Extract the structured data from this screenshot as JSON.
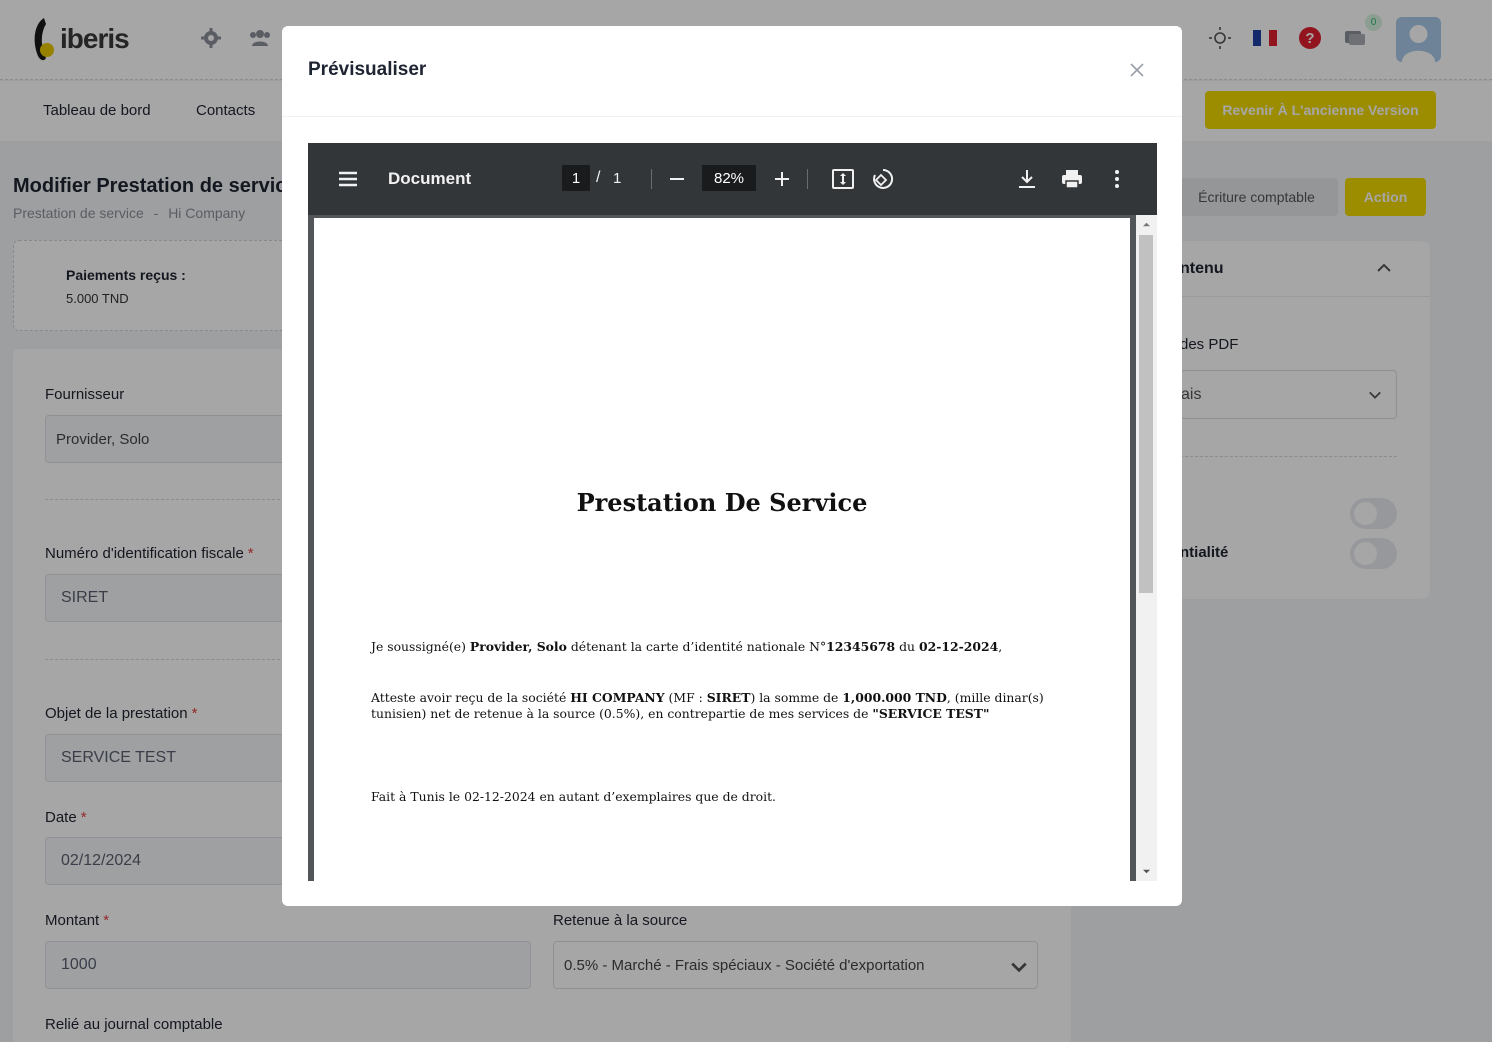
{
  "app": {
    "logo_text": "iberis",
    "notification_count": "0"
  },
  "nav": {
    "items": [
      "Tableau de bord",
      "Contacts"
    ],
    "revert_button": "Revenir À L'ancienne Version"
  },
  "page": {
    "title": "Modifier Prestation de servic",
    "breadcrumb": [
      "Prestation de service",
      "-",
      "Hi Company"
    ],
    "ecriture_button": "Écriture comptable",
    "action_button": "Action"
  },
  "payments": {
    "label": "Paiements reçus :",
    "value": "5.000 TND"
  },
  "form": {
    "fournisseur_label": "Fournisseur",
    "fournisseur_value": "Provider, Solo",
    "nif_label": "Numéro d'identification fiscale",
    "nif_value": "SIRET",
    "objet_label": "Objet de la prestation",
    "objet_value": "SERVICE TEST",
    "date_label": "Date",
    "date_value": "02/12/2024",
    "montant_label": "Montant",
    "montant_value": "1000",
    "retenue_label": "Retenue à la source",
    "retenue_value": "0.5% - Marché - Frais spéciaux - Société d'exportation",
    "journal_label": "Relié au journal comptable",
    "required_mark": "*"
  },
  "side": {
    "title": "ntenu",
    "pdf_label": "des PDF",
    "lang_value": "ais",
    "confid_label": "ntialité"
  },
  "modal": {
    "title": "Prévisualiser"
  },
  "viewer": {
    "doc_name": "Document",
    "page_current": "1",
    "page_sep": "/",
    "page_total": "1",
    "zoom": "82%"
  },
  "document": {
    "title": "Prestation De Service",
    "p1": {
      "t1": "Je soussigné(e) ",
      "name": "Provider, Solo",
      "t2": " détenant la carte d’identité nationale N°",
      "cin": "12345678",
      "t3": " du ",
      "date": "02-12-2024",
      "t4": ","
    },
    "p2": {
      "t1": "Atteste avoir reçu de la société ",
      "company": "HI COMPANY",
      "t2": " (MF : ",
      "mf": "SIRET",
      "t3": ") la somme de ",
      "amount": "1,000.000 TND",
      "t4": ", (mille dinar(s) tunisien) net de retenue à la source (0.5%), en contrepartie de mes services de ",
      "service": "\"SERVICE TEST\""
    },
    "p3": "Fait à Tunis le 02-12-2024 en autant d’exemplaires que de droit."
  },
  "colors": {
    "brand_yellow": "#f0d800",
    "viewer_toolbar": "#323639",
    "viewer_bg": "#525659",
    "required": "#e23c3c"
  }
}
